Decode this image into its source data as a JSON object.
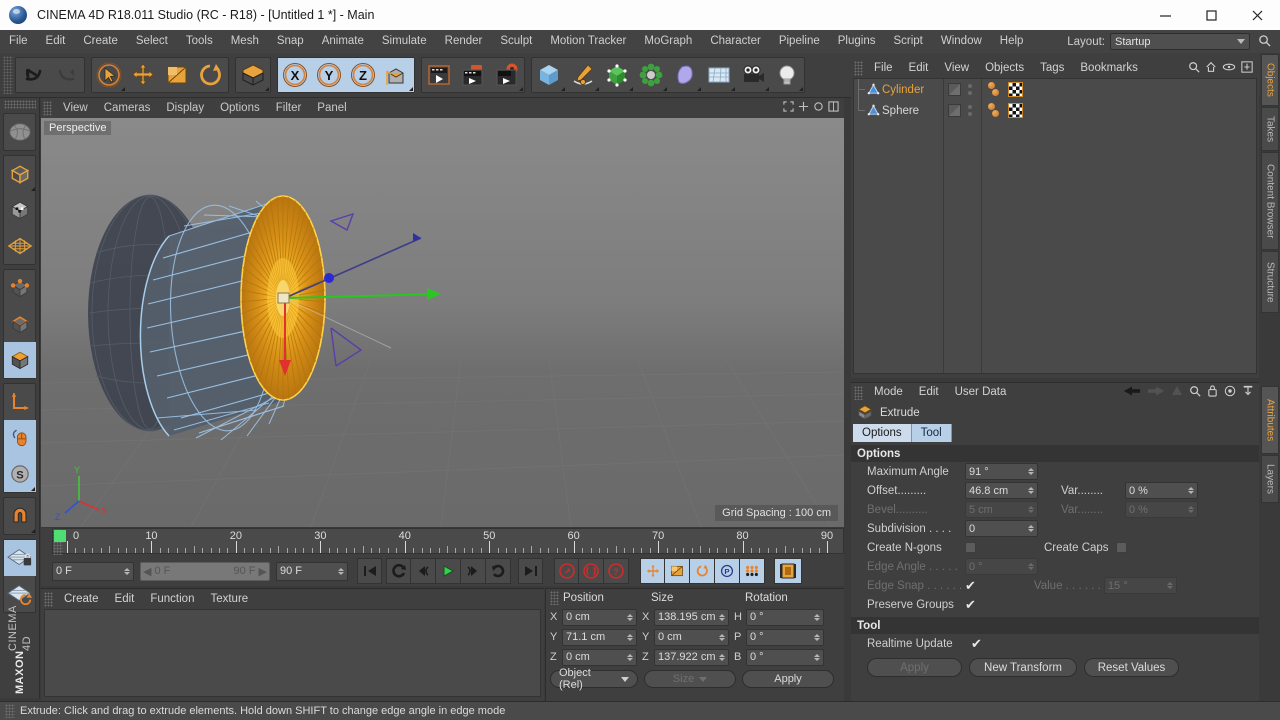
{
  "window": {
    "title": "CINEMA 4D R18.011 Studio (RC - R18) - [Untitled 1 *] - Main",
    "minimize": "—",
    "maximize": "□",
    "close": "✕"
  },
  "menubar": {
    "items": [
      "File",
      "Edit",
      "Create",
      "Select",
      "Tools",
      "Mesh",
      "Snap",
      "Animate",
      "Simulate",
      "Render",
      "Sculpt",
      "Motion Tracker",
      "MoGraph",
      "Character",
      "Pipeline",
      "Plugins",
      "Script",
      "Window",
      "Help"
    ],
    "layout_label": "Layout:",
    "layout_value": "Startup"
  },
  "toolbar": {
    "groups": [
      {
        "name": "history",
        "icons": [
          "undo-icon",
          "redo-icon"
        ]
      },
      {
        "name": "modes",
        "icons": [
          "select-live-icon",
          "move-icon",
          "scale-icon",
          "rotate-icon"
        ]
      },
      {
        "name": "workplane",
        "icons": [
          "workplane-icon"
        ]
      },
      {
        "name": "axis-locks",
        "icons": [
          "x-axis-icon",
          "y-axis-icon",
          "z-axis-icon",
          "world-object-axis-icon"
        ]
      },
      {
        "name": "render",
        "icons": [
          "render-view-icon",
          "render-region-icon",
          "render-settings-icon"
        ]
      },
      {
        "name": "objects",
        "icons": [
          "cube-primitive-icon",
          "spline-pen-icon",
          "nurbs-icon",
          "mograph-icon",
          "deformer-icon",
          "environment-icon",
          "camera-icon",
          "light-icon"
        ]
      }
    ]
  },
  "left_toolbar": {
    "icons": [
      "select-tool-icon",
      "model-mode-icon",
      "texture-mode-icon",
      "polygon-axis-icon",
      "point-mode-icon",
      "edge-mode-icon",
      "polygon-mode-icon",
      "axis-modify-icon",
      "enable-axis-icon",
      "soft-selection-icon",
      "magnet-icon",
      "workplane-lock-icon",
      "workplane-rotate-icon"
    ],
    "brand_top": "MAXON",
    "brand_bottom": "CINEMA 4D"
  },
  "viewport": {
    "menu": [
      "View",
      "Cameras",
      "Display",
      "Options",
      "Filter",
      "Panel"
    ],
    "label": "Perspective",
    "grid_spacing": "Grid Spacing : 100 cm",
    "axis_labels": {
      "y": "Y",
      "x": "X",
      "z": "Z"
    }
  },
  "timeline": {
    "ticks": [
      {
        "label": "0",
        "frame": 0
      },
      {
        "label": "10",
        "frame": 10
      },
      {
        "label": "20",
        "frame": 20
      },
      {
        "label": "30",
        "frame": 30
      },
      {
        "label": "40",
        "frame": 40
      },
      {
        "label": "50",
        "frame": 50
      },
      {
        "label": "60",
        "frame": 60
      },
      {
        "label": "70",
        "frame": 70
      },
      {
        "label": "80",
        "frame": 80
      },
      {
        "label": "90",
        "frame": 90
      }
    ],
    "range_min": 0,
    "range_max": 90,
    "current_frame_field": "0 F",
    "preview_start": "0 F",
    "preview_end": "90 F",
    "end_frame_field": "90 F",
    "right_frame_field": "0 F",
    "transport": [
      "go-to-start-icon",
      "play-backwards-icon",
      "previous-frame-icon",
      "play-forwards-icon",
      "next-frame-icon",
      "loop-icon",
      "go-to-end-icon"
    ],
    "keyframe_tools": [
      "record-key-icon",
      "autokey-icon",
      "keyframe-selection-icon"
    ],
    "key_toggles": [
      "position-key-icon",
      "scale-key-icon",
      "rotation-key-icon",
      "param-key-icon",
      "pla-key-icon"
    ],
    "timeline_toggle": "timeline-view-icon"
  },
  "material_manager": {
    "menu": [
      "Create",
      "Edit",
      "Function",
      "Texture"
    ],
    "materials": []
  },
  "coordinates": {
    "headers": [
      "Position",
      "Size",
      "Rotation"
    ],
    "rows": [
      {
        "pos_axis": "X",
        "pos_value": "0 cm",
        "size_axis": "X",
        "size_value": "138.195 cm",
        "rot_axis": "H",
        "rot_value": "0 °"
      },
      {
        "pos_axis": "Y",
        "pos_value": "71.1 cm",
        "size_axis": "Y",
        "size_value": "0 cm",
        "rot_axis": "P",
        "rot_value": "0 °"
      },
      {
        "pos_axis": "Z",
        "pos_value": "0 cm",
        "size_axis": "Z",
        "size_value": "137.922 cm",
        "rot_axis": "B",
        "rot_value": "0 °"
      }
    ],
    "mode_select": "Object (Rel)",
    "size_select": "Size",
    "apply_button": "Apply"
  },
  "status_bar": {
    "text": "Extrude: Click and drag to extrude elements. Hold down SHIFT to change edge angle in edge mode"
  },
  "object_manager": {
    "menu": [
      "File",
      "Edit",
      "View",
      "Objects",
      "Tags",
      "Bookmarks"
    ],
    "header_icons": [
      "search-icon",
      "home-icon",
      "link-icon",
      "expand-icon"
    ],
    "objects": [
      {
        "name": "Cylinder",
        "selected": true,
        "icon": "polygon-object-icon"
      },
      {
        "name": "Sphere",
        "selected": false,
        "icon": "polygon-object-icon"
      }
    ]
  },
  "attribute_manager": {
    "menu": [
      "Mode",
      "Edit",
      "User Data"
    ],
    "header_icons": [
      "back-arrow-icon",
      "forward-arrow-icon",
      "up-arrow-icon",
      "search-icon",
      "lock-icon",
      "target-icon",
      "pin-icon"
    ],
    "object_name": "Extrude",
    "object_icon": "extrude-tool-icon",
    "tabs": [
      {
        "label": "Options",
        "active": true
      },
      {
        "label": "Tool",
        "active": false
      }
    ],
    "options_section": "Options",
    "options": [
      {
        "label": "Maximum Angle",
        "value": "91 °",
        "disabled": false,
        "type": "field"
      },
      {
        "label": "Offset.........",
        "value": "46.8 cm",
        "disabled": false,
        "type": "field",
        "second_label": "Var........",
        "second_value": "0 %",
        "second_disabled": false
      },
      {
        "label": "Bevel..........",
        "value": "5 cm",
        "disabled": true,
        "type": "field",
        "second_label": "Var........",
        "second_value": "0 %",
        "second_disabled": true
      },
      {
        "label": "Subdivision . . . .",
        "value": "0",
        "disabled": false,
        "type": "field"
      },
      {
        "label": "Create N-gons",
        "value": "",
        "disabled": false,
        "type": "checkbox",
        "checked": false,
        "second_label": "Create Caps",
        "second_checked": false
      },
      {
        "label": "Edge Angle . . . . .",
        "value": "0 °",
        "disabled": true,
        "type": "field"
      },
      {
        "label": "Edge Snap . . . . . .",
        "value": "",
        "disabled": true,
        "type": "checkbox",
        "checked": true,
        "second_label": "Value . . . . . .",
        "second_value": "15 °",
        "second_disabled": true
      },
      {
        "label": "Preserve Groups",
        "value": "",
        "disabled": false,
        "type": "checkbox",
        "checked": true
      }
    ],
    "tool_section": "Tool",
    "realtime_label": "Realtime Update",
    "realtime_checked": true,
    "buttons": [
      {
        "label": "Apply",
        "disabled": true
      },
      {
        "label": "New Transform",
        "disabled": false
      },
      {
        "label": "Reset Values",
        "disabled": false
      }
    ]
  },
  "right_tabs": [
    {
      "label": "Objects",
      "active": true
    },
    {
      "label": "Takes",
      "active": false
    },
    {
      "label": "Content Browser",
      "active": false
    },
    {
      "label": "Structure",
      "active": false
    },
    {
      "label": "Attributes",
      "active": true
    },
    {
      "label": "Layers",
      "active": false
    }
  ],
  "colors": {
    "accent_orange": "#e8a33d",
    "selection_blue": "#b8cfe8",
    "panel_bg": "#3f3f3f",
    "field_bg": "#4f4f4f",
    "wireframe_blue": "#9dc4e8",
    "selected_poly": "#e0a020"
  }
}
